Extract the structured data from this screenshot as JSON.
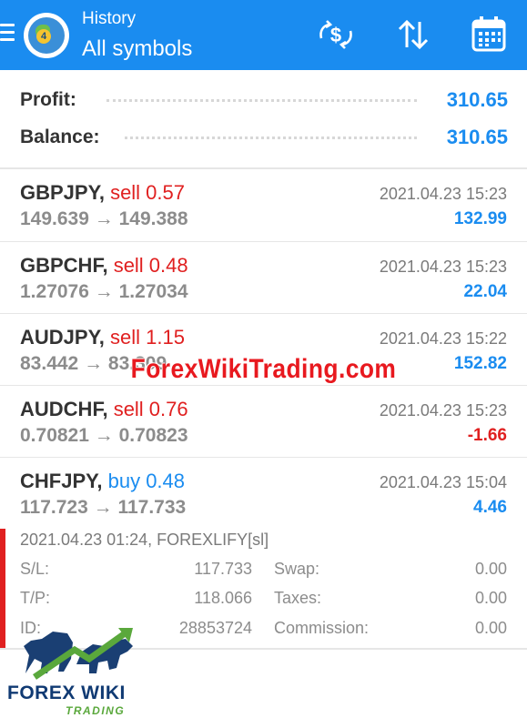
{
  "header": {
    "title_small": "History",
    "title_big": "All symbols",
    "accent_color": "#1a8cf0",
    "app_logo_badge": "4",
    "icons": [
      "menu-icon",
      "sort-by-symbol-icon",
      "sort-icon",
      "calendar-icon"
    ]
  },
  "summary": {
    "profit_label": "Profit:",
    "profit_value": "310.65",
    "balance_label": "Balance:",
    "balance_value": "310.65"
  },
  "deals": [
    {
      "symbol": "GBPJPY,",
      "side": "sell 0.57",
      "open_price": "149.639",
      "close_price": "149.388",
      "time": "2021.04.23 15:23",
      "profit": "132.99"
    },
    {
      "symbol": "GBPCHF,",
      "side": "sell 0.48",
      "open_price": "1.27076",
      "close_price": "1.27034",
      "time": "2021.04.23 15:23",
      "profit": "22.04"
    },
    {
      "symbol": "AUDJPY,",
      "side": "sell 1.15",
      "open_price": "83.442",
      "close_price": "83.309",
      "time": "2021.04.23 15:22",
      "profit": "152.82"
    },
    {
      "symbol": "AUDCHF,",
      "side": "sell 0.76",
      "open_price": "0.70821",
      "close_price": "0.70823",
      "time": "2021.04.23 15:23",
      "profit": "-1.66"
    },
    {
      "symbol": "CHFJPY,",
      "side": "buy 0.48",
      "open_price": "117.723",
      "close_price": "117.733",
      "time": "2021.04.23 15:04",
      "profit": "4.46"
    }
  ],
  "arrow_glyph": "→",
  "expanded_detail": {
    "comment": "2021.04.23 01:24, FOREXLIFY[sl]",
    "sl_label": "S/L:",
    "sl_value": "117.733",
    "tp_label": "T/P:",
    "tp_value": "118.066",
    "id_label": "ID:",
    "id_value": "28853724",
    "swap_label": "Swap:",
    "swap_value": "0.00",
    "taxes_label": "Taxes:",
    "taxes_value": "0.00",
    "commission_label": "Commission:",
    "commission_value": "0.00"
  },
  "watermark": {
    "text": "ForexWikiTrading.com"
  },
  "brand_logo": {
    "line1": "FOREX WIKI",
    "line2": "TRADING"
  }
}
